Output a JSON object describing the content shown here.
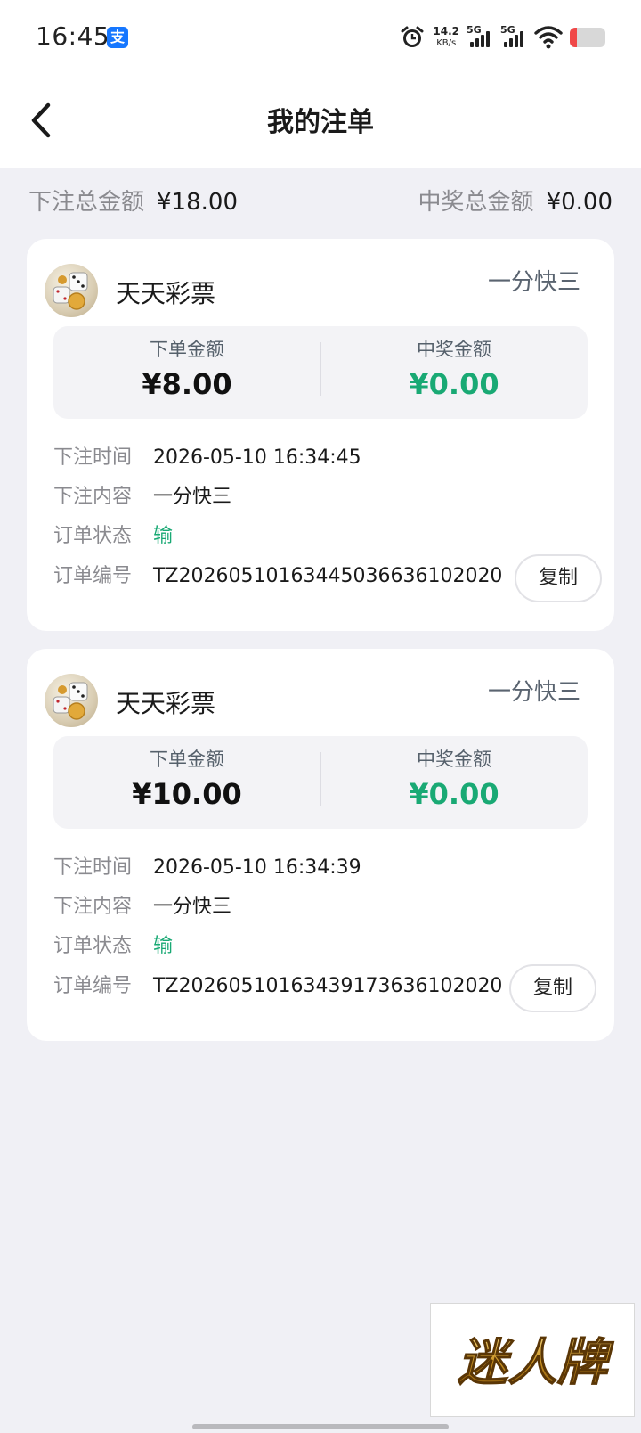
{
  "status_bar": {
    "time": "16:45",
    "app_icon": "alipay-icon",
    "speed_value": "14.2",
    "speed_unit": "KB/s",
    "signal1_label": "5G",
    "signal2_label": "5G",
    "battery_level": 0.2,
    "icons": [
      "alarm-icon",
      "signal-icon",
      "wifi-icon",
      "battery-icon"
    ]
  },
  "header": {
    "title": "我的注单",
    "back_icon": "chevron-left-icon"
  },
  "summary": {
    "bet_total_label": "下注总金额",
    "bet_total_value": "¥18.00",
    "win_total_label": "中奖总金额",
    "win_total_value": "¥0.00"
  },
  "orders": [
    {
      "store_name": "天天彩票",
      "game": "一分快三",
      "order_amount_label": "下单金额",
      "order_amount": "¥8.00",
      "win_amount_label": "中奖金额",
      "win_amount": "¥0.00",
      "rows": [
        {
          "label": "下注时间",
          "value": "2026-05-10 16:34:45"
        },
        {
          "label": "下注内容",
          "value": "一分快三"
        },
        {
          "label": "订单状态",
          "value": "输"
        },
        {
          "label": "订单编号",
          "value": "TZ20260510163445036636102020"
        }
      ],
      "copy_label": "复制"
    },
    {
      "store_name": "天天彩票",
      "game": "一分快三",
      "order_amount_label": "下单金额",
      "order_amount": "¥10.00",
      "win_amount_label": "中奖金额",
      "win_amount": "¥0.00",
      "rows": [
        {
          "label": "下注时间",
          "value": "2026-05-10 16:34:39"
        },
        {
          "label": "下注内容",
          "value": "一分快三"
        },
        {
          "label": "订单状态",
          "value": "输"
        },
        {
          "label": "订单编号",
          "value": "TZ20260510163439173636102020"
        }
      ],
      "copy_label": "复制"
    }
  ],
  "watermark": {
    "text": "迷人牌"
  },
  "colors": {
    "accent_green": "#19a974",
    "background": "#f0f0f5",
    "card": "#ffffff"
  }
}
